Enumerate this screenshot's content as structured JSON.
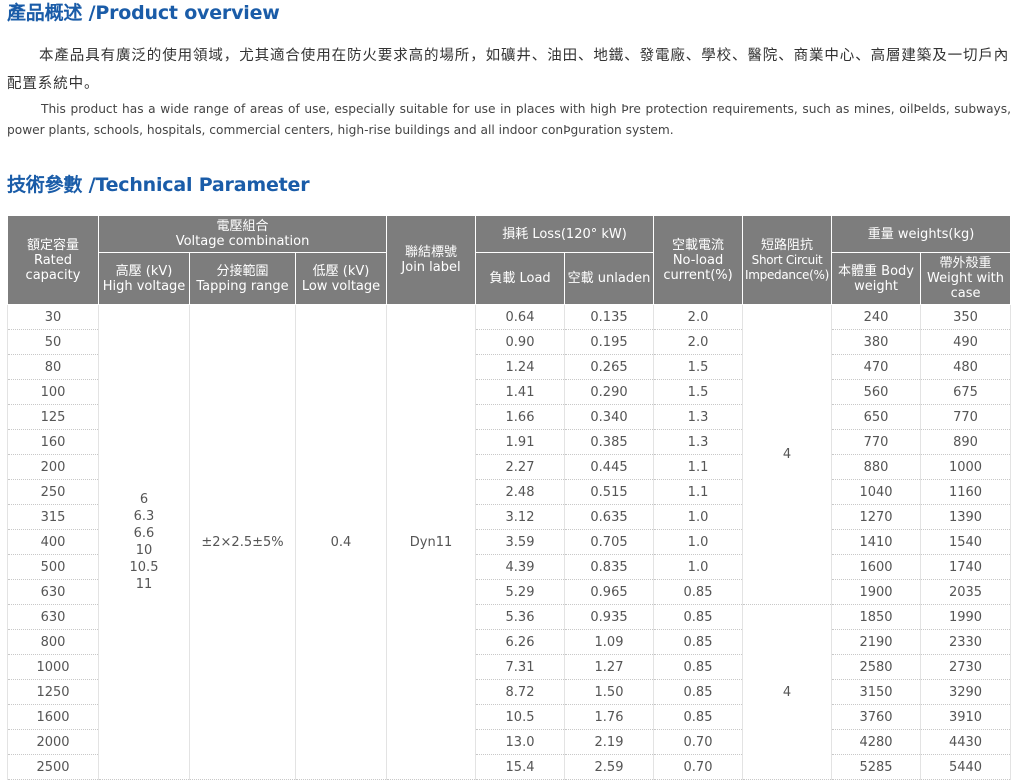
{
  "overview": {
    "title": "產品概述 /Product overview",
    "para_zh": "本產品具有廣泛的使用領域，尤其適合使用在防火要求高的場所，如礦井、油田、地鐵、發電廠、學校、醫院、商業中心、高層建築及一切戶內配置系統中。",
    "para_en": "This product has a wide range of areas of use, especially suitable for use in places with high Þre protection requirements, such as mines, oilÞelds, subways, power plants, schools, hospitals, commercial centers, high-rise buildings and all indoor conÞguration system."
  },
  "technical": {
    "title": "技術參數 /Technical Parameter",
    "headers": {
      "rated_capacity": {
        "zh": "額定容量",
        "en1": "Rated",
        "en2": "capacity"
      },
      "voltage_combination": {
        "zh": "電壓組合",
        "en": "Voltage combination"
      },
      "high_voltage": {
        "zh": "高壓 (kV)",
        "en": "High voltage"
      },
      "tapping_range": {
        "zh": "分接範圍",
        "en": "Tapping range"
      },
      "low_voltage": {
        "zh": "低壓 (kV)",
        "en": "Low voltage"
      },
      "join_label": {
        "zh": "聯結標號",
        "en": "Join label"
      },
      "loss": {
        "label": "損耗 Loss(120° kW)"
      },
      "load": {
        "label": "負載 Load"
      },
      "unladen": {
        "label": "空載 unladen"
      },
      "no_load_current": {
        "zh": "空載電流",
        "en1": "No-load",
        "en2": "current(%)"
      },
      "short_circuit": {
        "zh": "短路阻抗",
        "en1": "Short Circuit",
        "en2": "Impedance(%)"
      },
      "weights": {
        "label": "重量 weights(kg)"
      },
      "body_weight": {
        "zh": "本體重 Body",
        "en": "weight"
      },
      "case_weight": {
        "zh": "帶外殼重",
        "en1": "Weight with",
        "en2": "case"
      }
    },
    "merged": {
      "high_voltage_values": [
        "6",
        "6.3",
        "6.6",
        "10",
        "10.5",
        "11"
      ],
      "tapping_range": "±2×2.5±5%",
      "low_voltage": "0.4",
      "join_label": "Dyn11",
      "impedance_group1": "4",
      "impedance_group2": "4"
    },
    "rows": [
      {
        "capacity": "30",
        "load": "0.64",
        "unladen": "0.135",
        "current": "2.0",
        "body": "240",
        "case": "350"
      },
      {
        "capacity": "50",
        "load": "0.90",
        "unladen": "0.195",
        "current": "2.0",
        "body": "380",
        "case": "490"
      },
      {
        "capacity": "80",
        "load": "1.24",
        "unladen": "0.265",
        "current": "1.5",
        "body": "470",
        "case": "480"
      },
      {
        "capacity": "100",
        "load": "1.41",
        "unladen": "0.290",
        "current": "1.5",
        "body": "560",
        "case": "675"
      },
      {
        "capacity": "125",
        "load": "1.66",
        "unladen": "0.340",
        "current": "1.3",
        "body": "650",
        "case": "770"
      },
      {
        "capacity": "160",
        "load": "1.91",
        "unladen": "0.385",
        "current": "1.3",
        "body": "770",
        "case": "890"
      },
      {
        "capacity": "200",
        "load": "2.27",
        "unladen": "0.445",
        "current": "1.1",
        "body": "880",
        "case": "1000"
      },
      {
        "capacity": "250",
        "load": "2.48",
        "unladen": "0.515",
        "current": "1.1",
        "body": "1040",
        "case": "1160"
      },
      {
        "capacity": "315",
        "load": "3.12",
        "unladen": "0.635",
        "current": "1.0",
        "body": "1270",
        "case": "1390"
      },
      {
        "capacity": "400",
        "load": "3.59",
        "unladen": "0.705",
        "current": "1.0",
        "body": "1410",
        "case": "1540"
      },
      {
        "capacity": "500",
        "load": "4.39",
        "unladen": "0.835",
        "current": "1.0",
        "body": "1600",
        "case": "1740"
      },
      {
        "capacity": "630",
        "load": "5.29",
        "unladen": "0.965",
        "current": "0.85",
        "body": "1900",
        "case": "2035"
      },
      {
        "capacity": "630",
        "load": "5.36",
        "unladen": "0.935",
        "current": "0.85",
        "body": "1850",
        "case": "1990"
      },
      {
        "capacity": "800",
        "load": "6.26",
        "unladen": "1.09",
        "current": "0.85",
        "body": "2190",
        "case": "2330"
      },
      {
        "capacity": "1000",
        "load": "7.31",
        "unladen": "1.27",
        "current": "0.85",
        "body": "2580",
        "case": "2730"
      },
      {
        "capacity": "1250",
        "load": "8.72",
        "unladen": "1.50",
        "current": "0.85",
        "body": "3150",
        "case": "3290"
      },
      {
        "capacity": "1600",
        "load": "10.5",
        "unladen": "1.76",
        "current": "0.85",
        "body": "3760",
        "case": "3910"
      },
      {
        "capacity": "2000",
        "load": "13.0",
        "unladen": "2.19",
        "current": "0.70",
        "body": "4280",
        "case": "4430"
      },
      {
        "capacity": "2500",
        "load": "15.4",
        "unladen": "2.59",
        "current": "0.70",
        "body": "5285",
        "case": "5440"
      }
    ]
  },
  "colors": {
    "title": "#1a5ca8",
    "header_bg": "#7d7d7d",
    "header_text": "#ffffff",
    "body_text": "#555555"
  }
}
